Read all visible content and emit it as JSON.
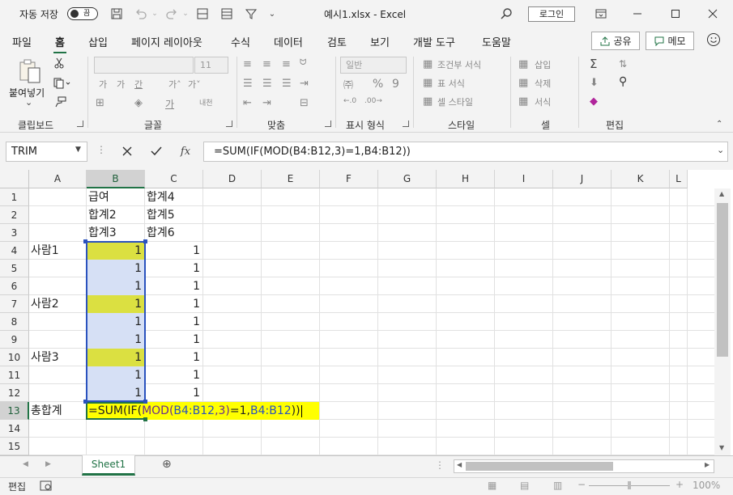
{
  "titlebar": {
    "autosave_label": "자동 저장",
    "toggle_state": "끔",
    "doc_title": "예시1.xlsx  -  Excel",
    "login_label": "로그인"
  },
  "menu": {
    "tabs": [
      "파일",
      "홈",
      "삽입",
      "페이지 레이아웃",
      "수식",
      "데이터",
      "검토",
      "보기",
      "개발 도구",
      "도움말"
    ],
    "active_tab": "홈",
    "share_label": "공유",
    "memo_label": "메모"
  },
  "ribbon": {
    "clipboard": {
      "label": "클립보드",
      "paste_label": "붙여넣기"
    },
    "font": {
      "label": "글꼴",
      "size": "11"
    },
    "alignment": {
      "label": "맞춤"
    },
    "number": {
      "label": "표시 형식",
      "format": "일반"
    },
    "styles": {
      "label": "스타일",
      "conditional": "조건부 서식",
      "table": "표 서식",
      "cell_style": "셀 스타일"
    },
    "cells": {
      "label": "셀",
      "insert": "삽입",
      "delete": "삭제",
      "format": "서식"
    },
    "editing": {
      "label": "편집"
    }
  },
  "formula_bar": {
    "name_box": "TRIM",
    "formula": "=SUM(IF(MOD(B4:B12,3)=1,B4:B12))"
  },
  "grid": {
    "columns": [
      "A",
      "B",
      "C",
      "D",
      "E",
      "F",
      "G",
      "H",
      "I",
      "J",
      "K",
      "L"
    ],
    "rows": [
      "1",
      "2",
      "3",
      "4",
      "5",
      "6",
      "7",
      "8",
      "9",
      "10",
      "11",
      "12",
      "13",
      "14",
      "15"
    ],
    "cells": {
      "B1": "급여",
      "C1": "합계4",
      "B2": "합계2",
      "C2": "합계5",
      "B3": "합계3",
      "C3": "합계6",
      "A4": "사람1",
      "A7": "사람2",
      "A10": "사람3",
      "A13": "총합계",
      "B4": "1",
      "B5": "1",
      "B6": "1",
      "B7": "1",
      "B8": "1",
      "B9": "1",
      "B10": "1",
      "B11": "1",
      "B12": "1",
      "C4": "1",
      "C5": "1",
      "C6": "1",
      "C7": "1",
      "C8": "1",
      "C9": "1",
      "C10": "1",
      "C11": "1",
      "C12": "1"
    },
    "edit_cell": {
      "p1": "=SUM(IF(",
      "p2": "MOD(",
      "p3": "B4:B12",
      "p4": ",3)",
      "p5": "=1,",
      "p6": "B4:B12",
      "p7": "))"
    }
  },
  "sheet_tabs": {
    "active": "Sheet1"
  },
  "status": {
    "mode": "편집",
    "zoom": "100%"
  },
  "colors": {
    "accent": "#217346",
    "highlight": "#dbe041",
    "edit_bg": "#ffff00",
    "range_fill": "#d6e0f5",
    "ref_blue": "#2a52be"
  }
}
